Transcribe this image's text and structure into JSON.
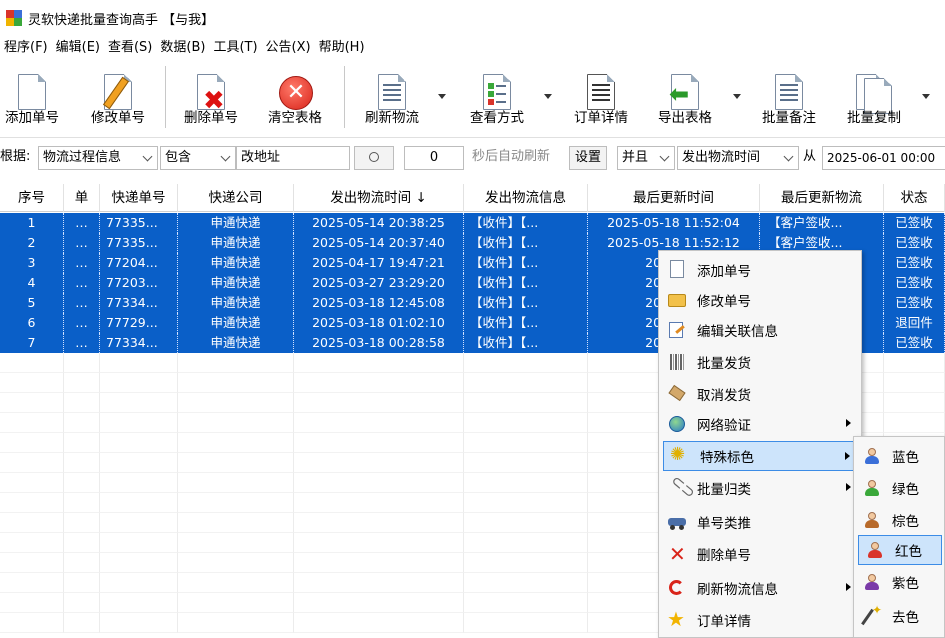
{
  "window": {
    "title": "灵软快递批量查询高手 【与我】"
  },
  "menu": [
    "程序(F)",
    "编辑(E)",
    "查看(S)",
    "数据(B)",
    "工具(T)",
    "公告(X)",
    "帮助(H)"
  ],
  "toolbar": {
    "add": "添加单号",
    "edit": "修改单号",
    "delete": "删除单号",
    "clear": "清空表格",
    "refresh": "刷新物流",
    "view_mode": "查看方式",
    "order_detail": "订单详情",
    "export": "导出表格",
    "batch_note": "批量备注",
    "batch_copy": "批量复制"
  },
  "filter": {
    "label": "根据:",
    "field": "物流过程信息",
    "op": "包含",
    "value": "改地址",
    "search_icon": "magnifier-icon",
    "seconds": "0",
    "auto_label": "秒后自动刷新",
    "set_btn": "设置",
    "logic": "并且",
    "field2": "发出物流时间",
    "from_label": "从",
    "from_date": "2025-06-01 00:00"
  },
  "table": {
    "columns": [
      "序号",
      "单",
      "快递单号",
      "快递公司",
      "发出物流时间 ↓",
      "发出物流信息",
      "最后更新时间",
      "最后更新物流",
      "状态"
    ],
    "rows": [
      [
        "1",
        "…",
        "77335...",
        "申通快递",
        "2025-05-14 20:38:25",
        "【收件】【...",
        "2025-05-18 11:52:04",
        "【客户签收...",
        "已签收"
      ],
      [
        "2",
        "…",
        "77335...",
        "申通快递",
        "2025-05-14 20:37:40",
        "【收件】【...",
        "2025-05-18 11:52:12",
        "【客户签收...",
        "已签收"
      ],
      [
        "3",
        "…",
        "77204...",
        "申通快递",
        "2025-04-17 19:47:21",
        "【收件】【...",
        "2025-04-",
        "",
        "已签收"
      ],
      [
        "4",
        "…",
        "77203...",
        "申通快递",
        "2025-03-27 23:29:20",
        "【收件】【...",
        "2025-03-",
        "",
        "已签收"
      ],
      [
        "5",
        "…",
        "77334...",
        "申通快递",
        "2025-03-18 12:45:08",
        "【收件】【...",
        "2025-03-",
        "",
        "已签收"
      ],
      [
        "6",
        "…",
        "77729...",
        "申通快递",
        "2025-03-18 01:02:10",
        "【收件】【...",
        "2025-03-",
        "",
        "退回件"
      ],
      [
        "7",
        "…",
        "77334...",
        "申通快递",
        "2025-03-18 00:28:58",
        "【收件】【...",
        "2025-04-",
        "",
        "已签收"
      ]
    ]
  },
  "context_menu": [
    {
      "label": "添加单号",
      "icon": "blank-doc-icon"
    },
    {
      "label": "修改单号",
      "icon": "folder-icon"
    },
    {
      "label": "编辑关联信息",
      "icon": "edit-form-icon"
    },
    {
      "label": "批量发货",
      "icon": "barcode-icon"
    },
    {
      "label": "取消发货",
      "icon": "tag-icon"
    },
    {
      "label": "网络验证",
      "icon": "globe-icon",
      "submenu": true
    },
    {
      "label": "特殊标色",
      "icon": "sparkle-icon",
      "submenu": true,
      "highlighted": true
    },
    {
      "label": "批量归类",
      "icon": "paperclip-icon",
      "submenu": true
    },
    {
      "label": "单号类推",
      "icon": "car-icon"
    },
    {
      "label": "删除单号",
      "icon": "red-x-icon"
    },
    {
      "label": "刷新物流信息",
      "icon": "refresh-icon",
      "submenu": true
    },
    {
      "label": "订单详情",
      "icon": "star-icon"
    }
  ],
  "color_submenu": [
    {
      "label": "蓝色",
      "color": "#3b6fd8"
    },
    {
      "label": "绿色",
      "color": "#3aa83a"
    },
    {
      "label": "棕色",
      "color": "#b86a2a"
    },
    {
      "label": "红色",
      "color": "#d9342b",
      "highlighted": true
    },
    {
      "label": "紫色",
      "color": "#7a3aa8"
    },
    {
      "label": "去色",
      "color": "#888888"
    }
  ]
}
